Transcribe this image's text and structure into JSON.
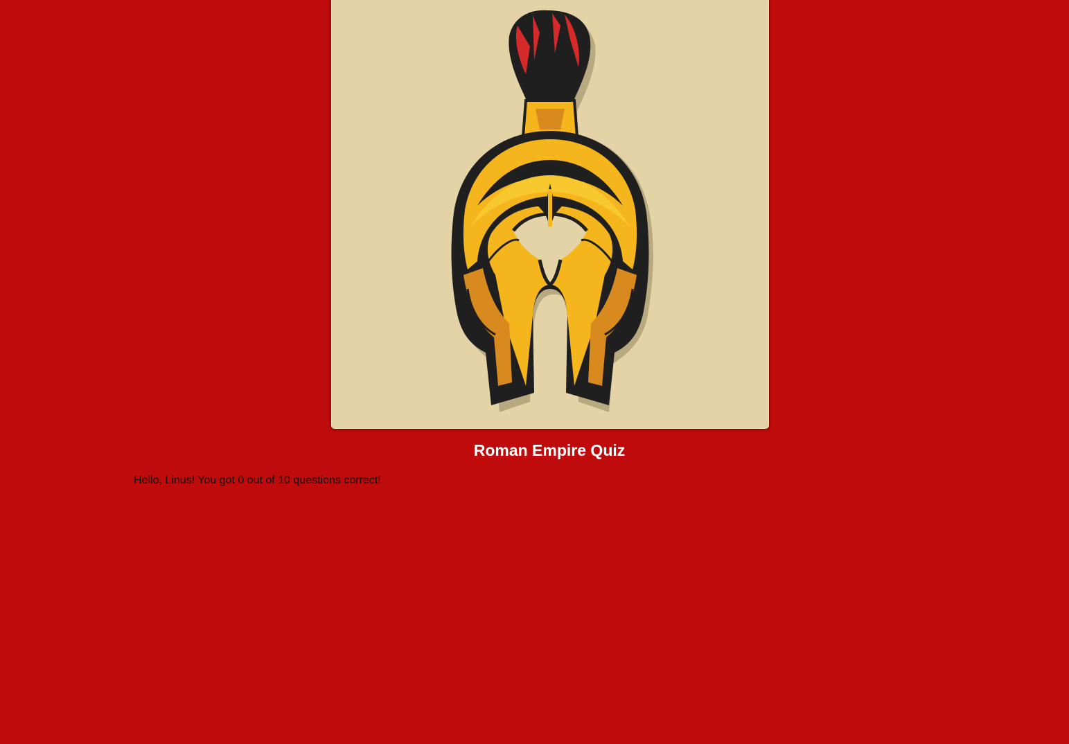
{
  "colors": {
    "background": "#bf0b0b",
    "card": "#e3d3a6",
    "title": "#ffffff",
    "text": "#111111"
  },
  "hero": {
    "image": "roman-helmet-icon"
  },
  "quiz": {
    "title": "Roman Empire Quiz",
    "result_message": "Hello, Linus! You got 0 out of 10 questions correct!"
  }
}
